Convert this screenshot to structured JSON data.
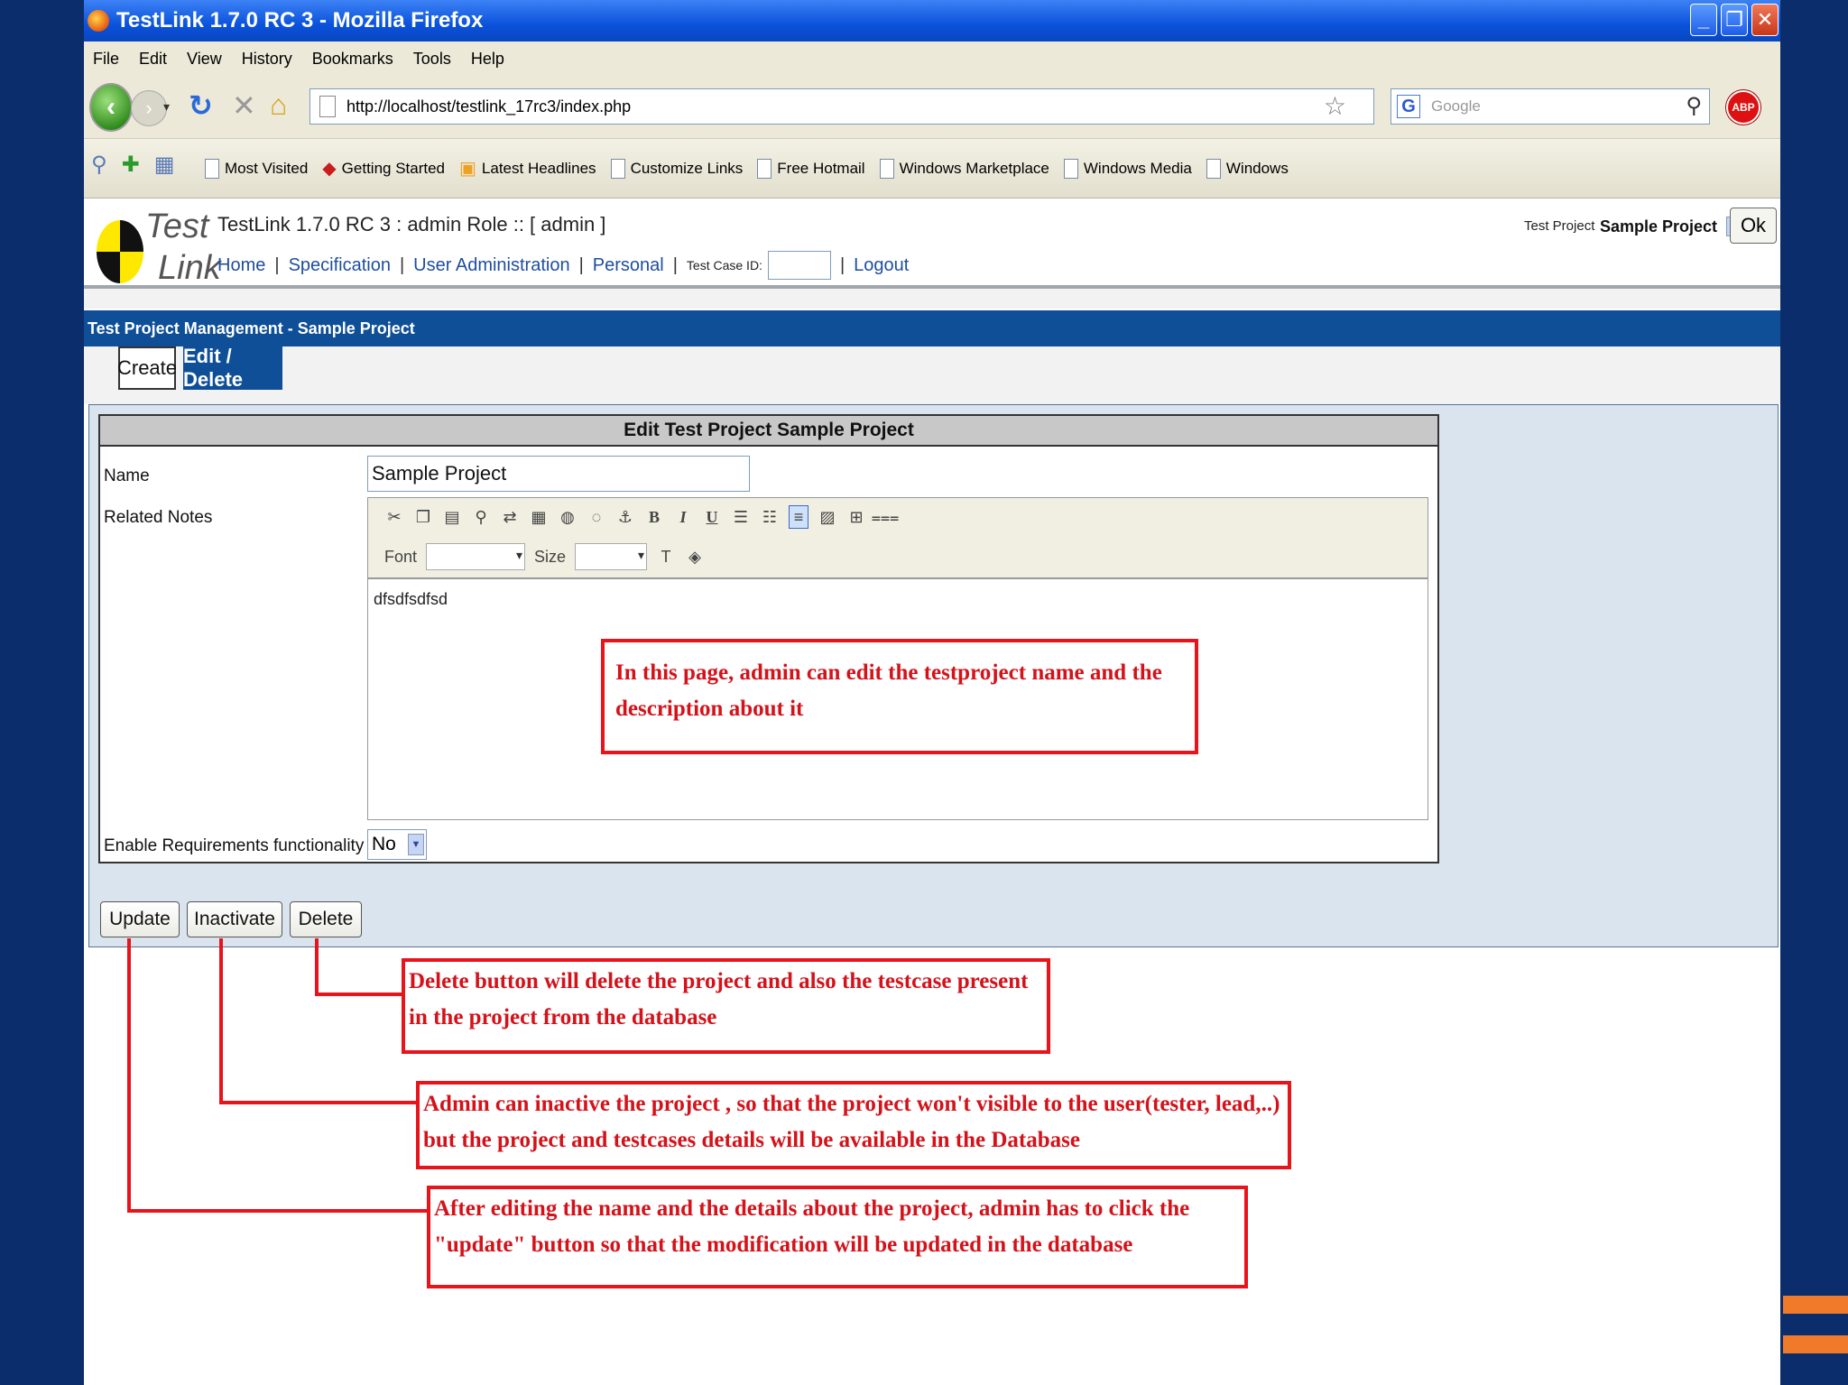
{
  "window": {
    "title": "TestLink 1.7.0 RC 3 - Mozilla Firefox"
  },
  "menu": [
    "File",
    "Edit",
    "View",
    "History",
    "Bookmarks",
    "Tools",
    "Help"
  ],
  "nav": {
    "url": "http://localhost/testlink_17rc3/index.php",
    "search_placeholder": "Google"
  },
  "bookmarks": [
    "Most Visited",
    "Getting Started",
    "Latest Headlines",
    "Customize Links",
    "Free Hotmail",
    "Windows Marketplace",
    "Windows Media",
    "Windows"
  ],
  "testlink": {
    "logo_top": "Test",
    "logo_bottom": "Link",
    "title": "TestLink 1.7.0 RC 3 : admin Role :: [ admin ]",
    "project_label": "Test Project",
    "project_value": "Sample Project",
    "ok_label": "Ok",
    "nav_items": [
      "Home",
      "Specification",
      "User Administration",
      "Personal"
    ],
    "test_case_id_label": "Test Case ID:",
    "logout_label": "Logout"
  },
  "section_title": "Test Project Management - Sample Project",
  "tabs": {
    "create": "Create",
    "edit_delete": "Edit / Delete"
  },
  "form": {
    "heading": "Edit Test Project Sample Project",
    "name_label": "Name",
    "name_value": "Sample Project",
    "notes_label": "Related Notes",
    "editor_font_label": "Font",
    "editor_size_label": "Size",
    "notes_value": "dfsdfsdfsd",
    "req_label": "Enable Requirements functionality",
    "req_value": "No"
  },
  "buttons": {
    "update": "Update",
    "inactivate": "Inactivate",
    "delete": "Delete"
  },
  "annotations": {
    "editor_note": [
      "In this page, admin can edit the testproject name and the",
      "description about it"
    ],
    "delete_note": [
      "Delete button will delete the project and also the testcase present",
      "in the project from the database"
    ],
    "inactivate_note": [
      "Admin can inactive the project , so that the project won't visible to the user(tester, lead,..)",
      "but the project and testcases details will be available in the Database"
    ],
    "update_note": [
      "After editing the name and the details about the project, admin has to click the",
      "\"update\" button so that the modification will be updated in the database"
    ]
  }
}
